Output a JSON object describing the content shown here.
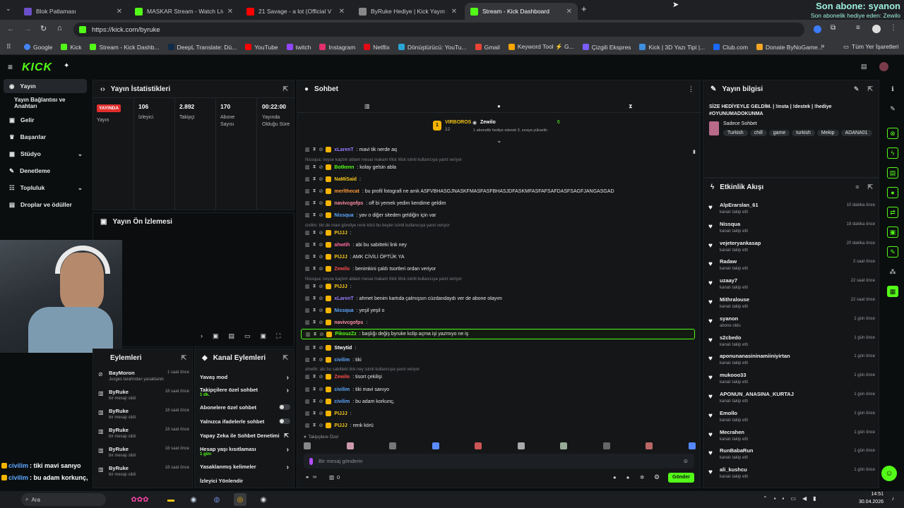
{
  "browser": {
    "tabs": [
      {
        "label": "Blok Patlaması"
      },
      {
        "label": "MASKAR Stream - Watch Live o"
      },
      {
        "label": "21 Savage - a lot (Official V"
      },
      {
        "label": "ByRuke Hediye | Kick Yayın Hed"
      },
      {
        "label": "Stream - Kick Dashboard"
      }
    ],
    "url": "https://kick.com/byruke",
    "bookmarks": [
      "Google",
      "Kick",
      "Stream - Kick Dashb...",
      "DeepL Translate: Dü...",
      "YouTube",
      "twitch",
      "Instagram",
      "Netflix",
      "Dönüştürücü: YouTu...",
      "Gmail",
      "Keyword Tool ⚡ G...",
      "Çizgili Ekspres",
      "Kick | 3D Yazı Tipi |...",
      "Club.com",
      "Donate ByNoGame..."
    ],
    "bookmarks_more": "»",
    "all_bookmarks": "Tüm Yer İşaretleri"
  },
  "overlay": {
    "sub_title": "Son abone: syanon",
    "gift_line": "Son abonelik hediye eden: Zewilo"
  },
  "kick": {
    "logo": "KICK"
  },
  "sidebar": {
    "items": [
      {
        "label": "Yayın"
      },
      {
        "label": "Yayın Bağlantısı ve Anahtarı"
      },
      {
        "label": "Gelir"
      },
      {
        "label": "Başarılar"
      },
      {
        "label": "Stüdyo"
      },
      {
        "label": "Denetleme"
      },
      {
        "label": "Topluluk"
      },
      {
        "label": "Droplar ve ödüller"
      }
    ]
  },
  "stats": {
    "title": "Yayın İstatistikleri",
    "live_badge": "YAYINDA",
    "cols": [
      {
        "value": "",
        "label": "Yayın"
      },
      {
        "value": "106",
        "label": "İzleyici"
      },
      {
        "value": "2.892",
        "label": "Takipçi"
      },
      {
        "value": "170",
        "label": "Abone Sayısı"
      },
      {
        "value": "00:22:00",
        "label": "Yayında Olduğu Süre"
      }
    ]
  },
  "preview": {
    "title": "Yayın Ön İzlemesi"
  },
  "modlog": {
    "title": "Eylemleri",
    "items": [
      {
        "name": "BayMoron",
        "sub": "Jusges tarafından yasaklandı",
        "time": "1 saat önce"
      },
      {
        "name": "ByRuke",
        "sub": "bir mesajı sildi",
        "time": "18 saat önce"
      },
      {
        "name": "ByRuke",
        "sub": "bir mesajı sildi",
        "time": "18 saat önce"
      },
      {
        "name": "ByRuke",
        "sub": "bir mesajı sildi",
        "time": "18 saat önce"
      },
      {
        "name": "ByRuke",
        "sub": "bir mesajı sildi",
        "time": "18 saat önce"
      },
      {
        "name": "ByRuke",
        "sub": "bir mesajı sildi",
        "time": "18 saat önce"
      }
    ]
  },
  "channel_actions": {
    "title": "Kanal Eylemleri",
    "items": [
      {
        "label": "Yavaş mod",
        "sub": ""
      },
      {
        "label": "Takipçilere özel sohbet",
        "sub": "1 dk."
      },
      {
        "label": "Abonelere özel sohbet",
        "sub": ""
      },
      {
        "label": "Yalnızca ifadelerle sohbet",
        "sub": ""
      },
      {
        "label": "Yapay Zeka ile Sohbet Denetimi",
        "sub": ""
      },
      {
        "label": "Hesap yaşı kısıtlaması",
        "sub": "1 gün"
      },
      {
        "label": "Yasaklanmış kelimeler",
        "sub": ""
      },
      {
        "label": "İzleyici Yönlendir",
        "sub": ""
      }
    ]
  },
  "chat": {
    "title": "Sohbet",
    "pinned": {
      "user1": "VIRBOROS",
      "count1": "12",
      "user2": "Zewilo",
      "count2": "6",
      "caption": "1 abonelik hediye ederek 3. sıraya yükselin"
    },
    "messages": [
      {
        "type": "msg",
        "user": "xLarenT",
        "color": "#9b7bff",
        "text": ": mavi tik nerde aq"
      },
      {
        "type": "reply",
        "text": "Nissqua: neyse kaçtım ablam mesai makam Mck Mck isimli kullanıcıya yanıt veriyor"
      },
      {
        "type": "msg",
        "user": "Botkenn",
        "color": "#53fc18",
        "text": ": kolay gelsin abla"
      },
      {
        "type": "msg",
        "user": "NaMiSaid",
        "color": "#f5c518",
        "text": ":"
      },
      {
        "type": "msg",
        "user": "merlthecat",
        "color": "#ff9a3c",
        "text": ": bu profil fotografi ne amk ASFVBHASGJNASKFMASFASFBHASJDFASKMFASFAFSAFDASFSAGFJANGASGAD"
      },
      {
        "type": "msg",
        "user": "navivcgofps",
        "color": "#ff8fa3",
        "text": ": off bi yemek yedim kendime geldim"
      },
      {
        "type": "msg",
        "user": "Nissqua",
        "color": "#5fa8ff",
        "text": ": yav o diğer siteden geldiğin için var"
      },
      {
        "type": "reply",
        "text": "civilim: tiki de mavi göreliye renk körü bu beyler isimli kullanıcıya yanıt veriyor"
      },
      {
        "type": "msg",
        "user": "PIJJJ",
        "color": "#f5c518",
        "text": ":"
      },
      {
        "type": "msg",
        "user": "ahwtih",
        "color": "#ff6b9d",
        "text": ": abi bu sabitteki link ney"
      },
      {
        "type": "msg",
        "user": "PIJJJ",
        "color": "#f5c518",
        "text": ": AMK CİVİLİ ÖPTÜK YA"
      },
      {
        "type": "msg",
        "user": "Zewilo",
        "color": "#ff4d4d",
        "text": ": benimkini çaldı tsortleri ordan veriyor"
      },
      {
        "type": "reply",
        "text": "Nissqua: neyse kaçtım ablam mesai makam Mck Mck isimli kullanıcıya yanıt veriyor"
      },
      {
        "type": "msg",
        "user": "PIJJJ",
        "color": "#f5c518",
        "text": ":"
      },
      {
        "type": "msg",
        "user": "xLarenT",
        "color": "#9b7bff",
        "text": ": ahmet benim kartıda çalmışsın cüzdandaydı ver de abone olayım"
      },
      {
        "type": "msg",
        "user": "Nissqua",
        "color": "#5fa8ff",
        "text": ": yeşil yeşil o"
      },
      {
        "type": "msg",
        "user": "navivcgofps",
        "color": "#ff8fa3",
        "text": ":"
      },
      {
        "type": "msg",
        "user": "PikouzZz",
        "color": "#53fc18",
        "text": ": başlığı değiş byruke kclip açma işi yazmıyo ne iş",
        "highlight": true
      },
      {
        "type": "msg",
        "user": "Stwytid",
        "color": "#ffffff",
        "text": ":"
      },
      {
        "type": "msg",
        "user": "civilim",
        "color": "#5fa8ff",
        "text": ": tiki"
      },
      {
        "type": "reply",
        "text": "ahwtih: abi bu sabitteki link ney isimli kullanıcıya yanıt veriyor"
      },
      {
        "type": "msg",
        "user": "Zewilo",
        "color": "#ff4d4d",
        "text": ": tisort çekilişi"
      },
      {
        "type": "msg",
        "user": "civilim",
        "color": "#5fa8ff",
        "text": ": tiki mavi sanıyo"
      },
      {
        "type": "msg",
        "user": "civilim",
        "color": "#5fa8ff",
        "text": ": bu adam korkunç,"
      },
      {
        "type": "msg",
        "user": "PIJJJ",
        "color": "#f5c518",
        "text": ":"
      },
      {
        "type": "msg",
        "user": "PIJJJ",
        "color": "#f5c518",
        "text": ": renk körü"
      }
    ],
    "followers_only": "Takipçilere Özel",
    "placeholder": "Bir mesaj gönderin",
    "bottom_left": "∞",
    "bottom_count": "0",
    "send": "Gönder"
  },
  "stream_info": {
    "title": "Yayın bilgisi",
    "stream_title": "SİZE HEDİYEYLE GELDİM. | !insta | !destek | !hediye #OYUNUMADOKUNMA",
    "category": "Sadece Sohbet",
    "tags": [
      "Turkish",
      "chill",
      "game",
      "turkish",
      "Mekip",
      "ADANA01"
    ]
  },
  "activity": {
    "title": "Etkinlik Akışı",
    "items": [
      {
        "name": "AlpErarslan_61",
        "sub": "kanalı takip etti",
        "time": "10 dakika önce"
      },
      {
        "name": "Nissqua",
        "sub": "kanalı takip etti",
        "time": "18 dakika önce"
      },
      {
        "name": "vejeteryankasap",
        "sub": "kanalı takip etti",
        "time": "20 dakika önce"
      },
      {
        "name": "Radaw",
        "sub": "kanalı takip etti",
        "time": "2 saat önce"
      },
      {
        "name": "uzaay7",
        "sub": "kanalı takip etti",
        "time": "22 saat önce"
      },
      {
        "name": "Mithralouse",
        "sub": "kanalı takip etti",
        "time": "22 saat önce"
      },
      {
        "name": "syanon",
        "sub": "abone oldu",
        "time": "1 gün önce"
      },
      {
        "name": "s2cbedo",
        "sub": "kanalı takip etti",
        "time": "1 gün önce"
      },
      {
        "name": "aponunanasininamiiniyirtan",
        "sub": "kanalı takip etti",
        "time": "1 gün önce"
      },
      {
        "name": "mukooo33",
        "sub": "kanalı takip etti",
        "time": "1 gün önce"
      },
      {
        "name": "APONUN_ANASINA_KURTAJ",
        "sub": "kanalı takip etti",
        "time": "1 gün önce"
      },
      {
        "name": "Emollo",
        "sub": "kanalı takip etti",
        "time": "1 gün önce"
      },
      {
        "name": "Mecrahen",
        "sub": "kanalı takip etti",
        "time": "1 gün önce"
      },
      {
        "name": "RunBabaRun",
        "sub": "kanalı takip etti",
        "time": "1 gün önce"
      },
      {
        "name": "ali_kushcu",
        "sub": "kanalı takip etti",
        "time": "1 gün önce"
      }
    ]
  },
  "overlay_chat": [
    {
      "user": "civilim",
      "text": " : tiki mavi sanıyo"
    },
    {
      "user": "civilim",
      "text": " : bu adam korkunç,"
    }
  ],
  "taskbar": {
    "search": "Ara",
    "time": "14:51",
    "date": "30.04.2026"
  }
}
